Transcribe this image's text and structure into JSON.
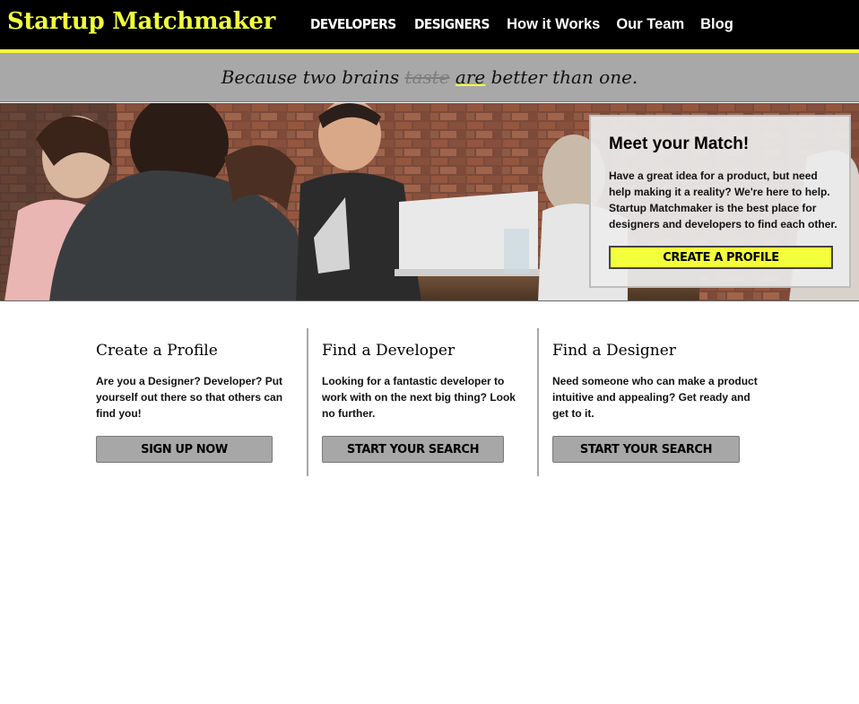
{
  "header": {
    "brand": "Startup Matchmaker",
    "nav": [
      "DEVELOPERS",
      "DESIGNERS",
      "How it Works",
      "Our Team",
      "Blog"
    ]
  },
  "tagline": {
    "before": "Because two brains ",
    "struck": "taste",
    "space": " ",
    "underlined": "are",
    "after": " better than one."
  },
  "hero": {
    "card": {
      "title": "Meet your Match!",
      "text": "Have a great idea for a product, but need help making it a reality? We're here to help. Startup Matchmaker is the best place for designers and developers to find each other.",
      "button": "CREATE A PROFILE"
    }
  },
  "columns": [
    {
      "title": "Create a Profile",
      "text": "Are you a Designer? Developer? Put yourself out there so that others can find you!",
      "button": "SIGN UP NOW"
    },
    {
      "title": "Find a Developer",
      "text": "Looking for a fantastic developer to work with on the next big thing? Look no further.",
      "button": "START YOUR SEARCH"
    },
    {
      "title": "Find a Designer",
      "text": "Need someone who can make a product intuitive and appealing? Get ready and get to it.",
      "button": "START YOUR SEARCH"
    }
  ],
  "colors": {
    "accent": "#f2ff3a",
    "header_bg": "#000000",
    "tagline_bg": "#a8a8a8",
    "button_gray": "#a7a7a7"
  }
}
